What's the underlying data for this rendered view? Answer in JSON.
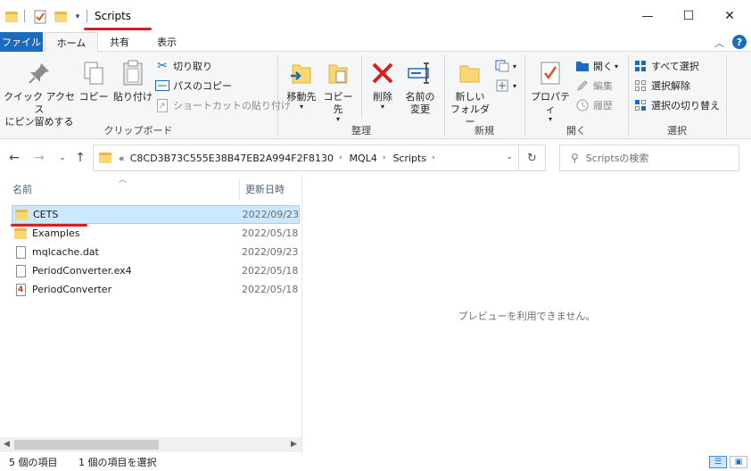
{
  "window": {
    "title": "Scripts",
    "minimize": "—",
    "maximize": "☐",
    "close": "✕"
  },
  "tabs": {
    "file": "ファイル",
    "home": "ホーム",
    "share": "共有",
    "view": "表示"
  },
  "ribbon": {
    "clipboard": {
      "label": "クリップボード",
      "pin_line1": "クイック アクセス",
      "pin_line2": "にピン留めする",
      "copy": "コピー",
      "paste": "貼り付け",
      "cut": "切り取り",
      "copy_path": "パスのコピー",
      "paste_shortcut": "ショートカットの貼り付け"
    },
    "organize": {
      "label": "整理",
      "move_to": "移動先",
      "copy_to": "コピー先",
      "delete": "削除",
      "rename_line1": "名前の",
      "rename_line2": "変更"
    },
    "new": {
      "label": "新規",
      "new_folder_line1": "新しい",
      "new_folder_line2": "フォルダー"
    },
    "open": {
      "label": "開く",
      "properties": "プロパティ",
      "open": "開く",
      "edit": "編集",
      "history": "履歴"
    },
    "select": {
      "label": "選択",
      "select_all": "すべて選択",
      "select_none": "選択解除",
      "invert": "選択の切り替え"
    }
  },
  "address": {
    "prefix": "«",
    "crumbs": [
      "C8CD3B73C555E38B47EB2A994F2F8130",
      "MQL4",
      "Scripts"
    ],
    "search_placeholder": "Scriptsの検索"
  },
  "columns": {
    "name": "名前",
    "date": "更新日時"
  },
  "files": [
    {
      "name": "CETS",
      "date": "2022/09/23",
      "type": "folder"
    },
    {
      "name": "Examples",
      "date": "2022/05/18",
      "type": "folder"
    },
    {
      "name": "mqlcache.dat",
      "date": "2022/09/23",
      "type": "file"
    },
    {
      "name": "PeriodConverter.ex4",
      "date": "2022/05/18",
      "type": "ex4"
    },
    {
      "name": "PeriodConverter",
      "date": "2022/05/18",
      "type": "mq4"
    }
  ],
  "preview": {
    "message": "プレビューを利用できません。"
  },
  "status": {
    "item_count": "5 個の項目",
    "selected": "1 個の項目を選択"
  },
  "colors": {
    "accent": "#1c6bbf",
    "selection": "#cce8ff",
    "annotation_red": "#d42020",
    "folder": "#f8d775"
  }
}
